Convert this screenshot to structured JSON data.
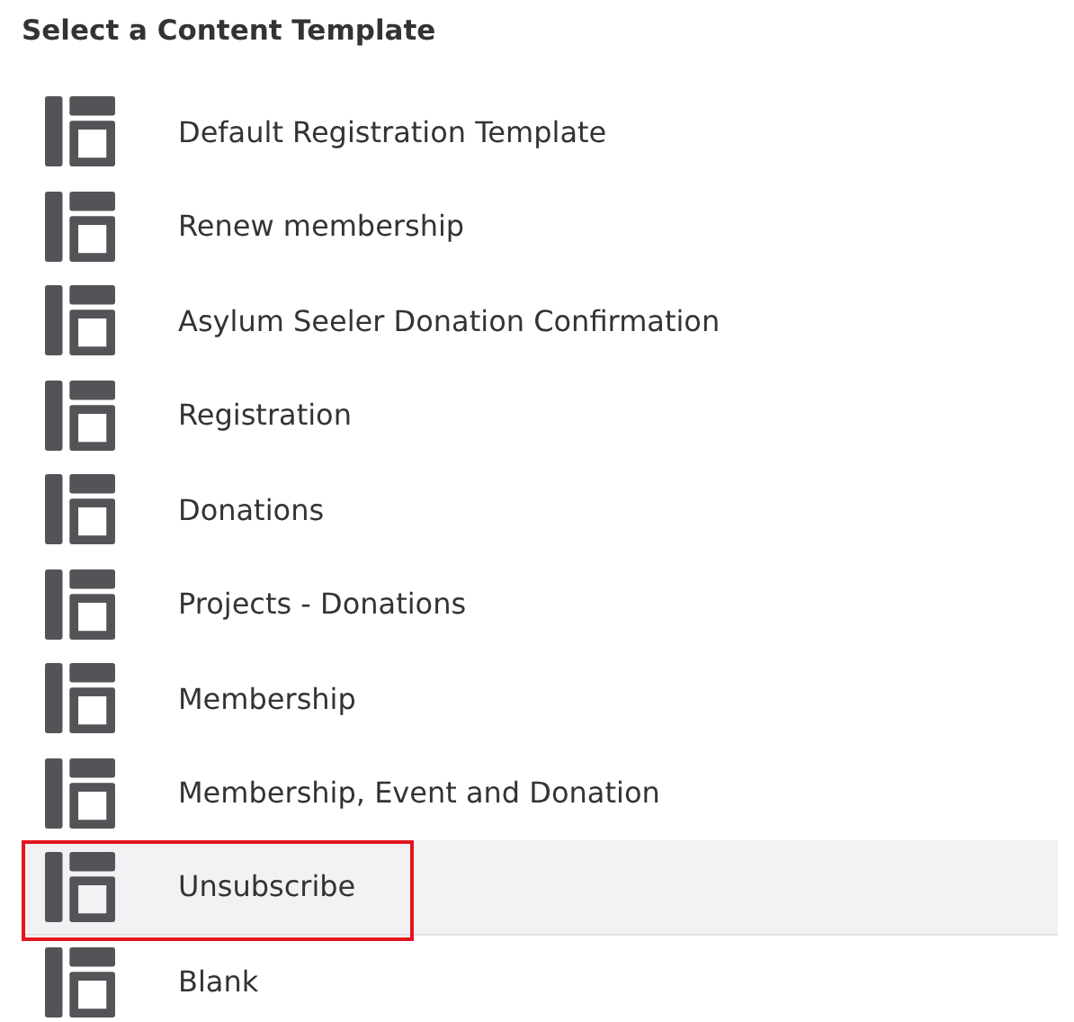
{
  "title": "Select a Content Template",
  "templates": [
    {
      "label": "Default Registration Template",
      "selected": false
    },
    {
      "label": "Renew membership",
      "selected": false
    },
    {
      "label": "Asylum Seeler Donation Confirmation",
      "selected": false
    },
    {
      "label": "Registration",
      "selected": false
    },
    {
      "label": "Donations",
      "selected": false
    },
    {
      "label": "Projects - Donations",
      "selected": false
    },
    {
      "label": "Membership",
      "selected": false
    },
    {
      "label": "Membership, Event and Donation",
      "selected": false
    },
    {
      "label": "Unsubscribe",
      "selected": true
    },
    {
      "label": "Blank",
      "selected": false
    }
  ]
}
